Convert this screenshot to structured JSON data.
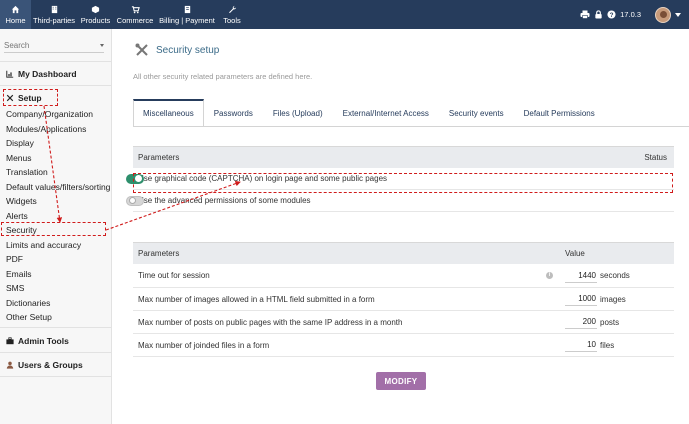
{
  "topnav": {
    "items": [
      {
        "label": "Home",
        "icon": "home-icon"
      },
      {
        "label": "Third-parties",
        "icon": "building-icon"
      },
      {
        "label": "Products",
        "icon": "cube-icon"
      },
      {
        "label": "Commerce",
        "icon": "cart-icon"
      },
      {
        "label": "Billing | Payment",
        "icon": "invoice-icon"
      },
      {
        "label": "Tools",
        "icon": "wrench-icon"
      }
    ],
    "version": "17.0.3"
  },
  "sidebar": {
    "search_placeholder": "Search",
    "my_dashboard": "My Dashboard",
    "setup": "Setup",
    "setup_items": [
      "Company/Organization",
      "Modules/Applications",
      "Display",
      "Menus",
      "Translation",
      "Default values/filters/sorting",
      "Widgets",
      "Alerts",
      "Security",
      "Limits and accuracy",
      "PDF",
      "Emails",
      "SMS",
      "Dictionaries",
      "Other Setup"
    ],
    "admin_tools": "Admin Tools",
    "users_groups": "Users & Groups"
  },
  "page": {
    "title": "Security setup",
    "subtitle": "All other security related parameters are defined here.",
    "tabs": [
      "Miscellaneous",
      "Passwords",
      "Files (Upload)",
      "External/Internet Access",
      "Security events",
      "Default Permissions"
    ]
  },
  "table1": {
    "col_parameters": "Parameters",
    "col_status": "Status",
    "rows": [
      {
        "label": "Use graphical code (CAPTCHA) on login page and some public pages",
        "enabled": true
      },
      {
        "label": "Use the advanced permissions of some modules",
        "enabled": false
      }
    ]
  },
  "table2": {
    "col_parameters": "Parameters",
    "col_value": "Value",
    "rows": [
      {
        "label": "Time out for session",
        "value": "1440",
        "unit": "seconds"
      },
      {
        "label": "Max number of images allowed in a HTML field submitted in a form",
        "value": "1000",
        "unit": "images"
      },
      {
        "label": "Max number of posts on public pages with the same IP address in a month",
        "value": "200",
        "unit": "posts"
      },
      {
        "label": "Max number of joinded files in a form",
        "value": "10",
        "unit": "files"
      }
    ]
  },
  "modify_label": "MODIFY",
  "colors": {
    "topbar": "#263c5c",
    "accent": "#3b6b88",
    "toggle_on": "#2e8f6c",
    "modify": "#a26fa8",
    "annotation": "#d01b1b"
  }
}
